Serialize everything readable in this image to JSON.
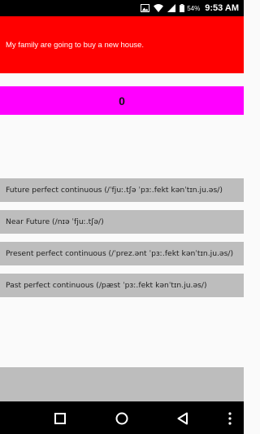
{
  "status_bar": {
    "battery_percent": "54%",
    "time": "9:53 AM"
  },
  "question": {
    "sentence": "My family are going to buy a new house.",
    "bg_color": "#ff0000"
  },
  "score": {
    "value": "0",
    "bg_color": "#ff00ff"
  },
  "options": [
    {
      "label": "Future perfect continuous  (/ˈfjuː.tʃə  ˈpɜː.fekt  kənˈtɪn.ju.əs/)"
    },
    {
      "label": "Near Future  (/nɪə  ˈfjuː.tʃə/)"
    },
    {
      "label": "Present perfect continuous  (/ˈprez.ənt  ˈpɜː.fekt  kənˈtɪn.ju.əs/)"
    },
    {
      "label": "Past perfect continuous  (/pæst  ˈpɜː.fekt  kənˈtɪn.ju.əs/)"
    }
  ],
  "icons": {
    "status": [
      "image-icon",
      "wifi-icon",
      "signal-icon",
      "battery-icon"
    ],
    "nav": [
      "recents-square-icon",
      "home-circle-icon",
      "back-triangle-icon",
      "more-vertical-icon"
    ]
  }
}
